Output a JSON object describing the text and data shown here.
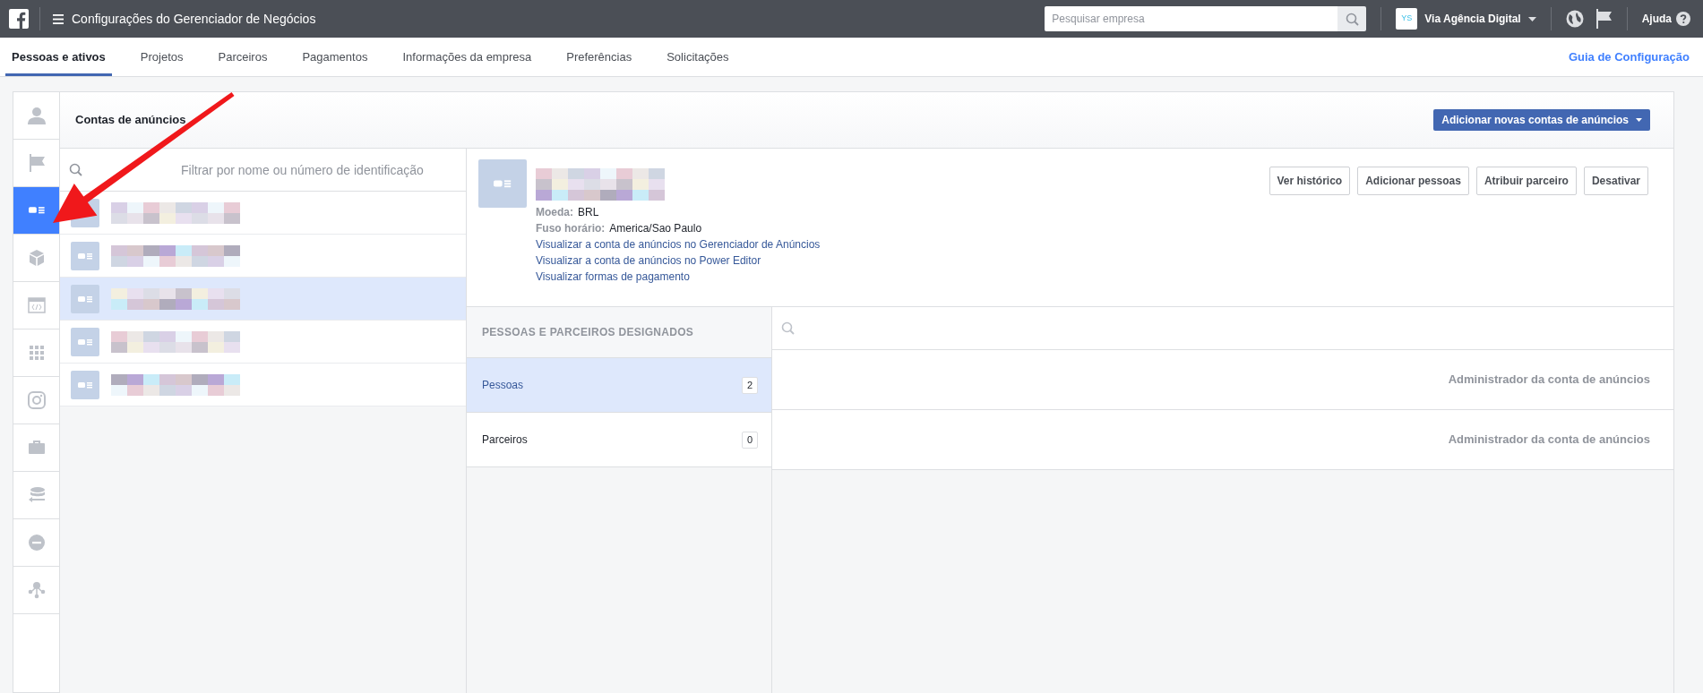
{
  "top_bar": {
    "title": "Configurações do Gerenciador de Negócios",
    "search": {
      "placeholder": "Pesquisar empresa"
    },
    "account": {
      "initials": "YS",
      "name": "Via Agência Digital"
    },
    "help": "Ajuda"
  },
  "tabs": [
    {
      "label": "Pessoas e ativos",
      "selected": true
    },
    {
      "label": "Projetos",
      "selected": false
    },
    {
      "label": "Parceiros",
      "selected": false
    },
    {
      "label": "Pagamentos",
      "selected": false
    },
    {
      "label": "Informações da empresa",
      "selected": false
    },
    {
      "label": "Preferências",
      "selected": false
    },
    {
      "label": "Solicitações",
      "selected": false
    }
  ],
  "setup_guide": "Guia de Configuração",
  "sidebar": {
    "items": [
      {
        "kind": "person",
        "selected": false
      },
      {
        "kind": "flag",
        "selected": false
      },
      {
        "kind": "ad_account",
        "selected": true
      },
      {
        "kind": "cube",
        "selected": false
      },
      {
        "kind": "code",
        "selected": false
      },
      {
        "kind": "grid",
        "selected": false
      },
      {
        "kind": "instagram",
        "selected": false
      },
      {
        "kind": "briefcase",
        "selected": false
      },
      {
        "kind": "sync",
        "selected": false
      },
      {
        "kind": "block",
        "selected": false
      },
      {
        "kind": "network",
        "selected": false
      }
    ]
  },
  "panel": {
    "title": "Contas de anúncios",
    "add_button": "Adicionar novas contas de anúncios",
    "filter": {
      "placeholder": "Filtrar por nome ou número de identificação"
    },
    "accounts": [
      {
        "selected": false
      },
      {
        "selected": false
      },
      {
        "selected": true
      },
      {
        "selected": false
      },
      {
        "selected": false
      }
    ]
  },
  "detail": {
    "buttons": [
      "Ver histórico",
      "Adicionar pessoas",
      "Atribuir parceiro",
      "Desativar"
    ],
    "fields": [
      {
        "label": "Moeda:",
        "value": "BRL"
      },
      {
        "label": "Fuso horário:",
        "value": "America/Sao Paulo"
      }
    ],
    "links": [
      "Visualizar a conta de anúncios no Gerenciador de Anúncios",
      "Visualizar a conta de anúncios no Power Editor",
      "Visualizar formas de pagamento"
    ],
    "assigned": {
      "heading": "PESSOAS E PARCEIROS DESIGNADOS",
      "items": [
        {
          "label": "Pessoas",
          "count": "2",
          "selected": true
        },
        {
          "label": "Parceiros",
          "count": "0",
          "selected": false
        }
      ]
    },
    "members": [
      {
        "role": "Administrador da conta de anúncios"
      },
      {
        "role": "Administrador da conta de anúncios"
      }
    ]
  }
}
